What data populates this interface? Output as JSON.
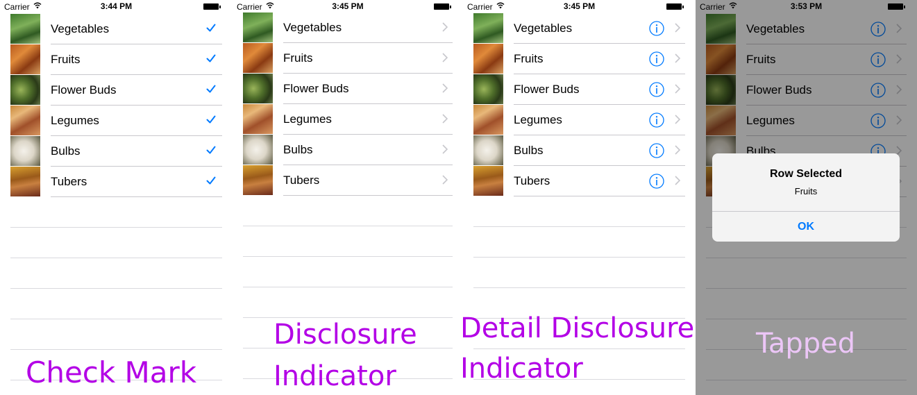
{
  "accent_color": "#007aff",
  "caption_color": "#b300e6",
  "status": {
    "carrier": "Carrier"
  },
  "rows": [
    "Vegetables",
    "Fruits",
    "Flower Buds",
    "Legumes",
    "Bulbs",
    "Tubers"
  ],
  "panels": [
    {
      "time": "3:44 PM",
      "accessory": "checkmark",
      "caption": [
        "Check Mark"
      ]
    },
    {
      "time": "3:45 PM",
      "accessory": "disclosure-indicator",
      "caption": [
        "Disclosure",
        "Indicator"
      ]
    },
    {
      "time": "3:45 PM",
      "accessory": "detail-disclosure",
      "caption": [
        "Detail Disclosure",
        "Indicator"
      ]
    },
    {
      "time": "3:53 PM",
      "accessory": "detail-disclosure",
      "caption": [
        "Tapped"
      ]
    }
  ],
  "alert": {
    "title": "Row Selected",
    "message": "Fruits",
    "button": "OK"
  }
}
